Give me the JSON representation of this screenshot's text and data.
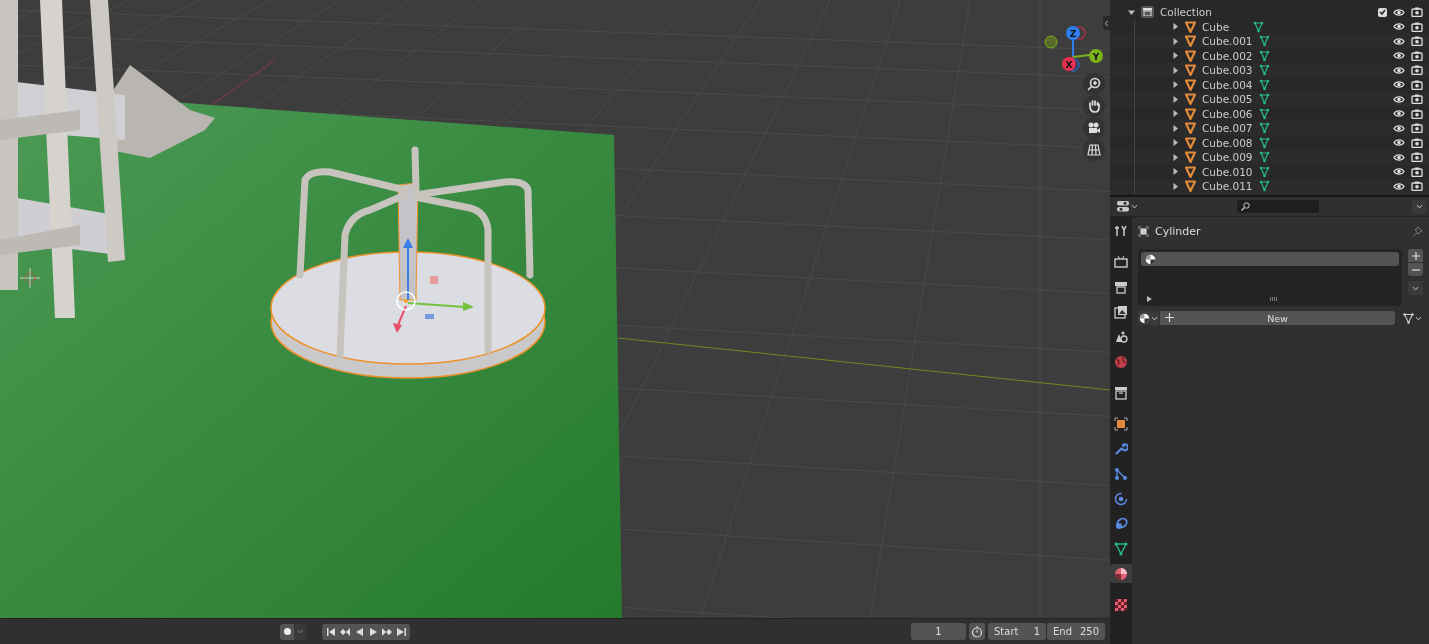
{
  "viewport": {
    "gizmo_axes": [
      "Z",
      "Y",
      "X"
    ]
  },
  "timeline": {
    "current_frame": "1",
    "start_label": "Start",
    "start": "1",
    "end_label": "End",
    "end": "250"
  },
  "outliner": {
    "collection": {
      "name": "Collection",
      "expanded": true,
      "checked": true,
      "children": [
        {
          "name": "Cube",
          "expanded": false
        },
        {
          "name": "Cube.001",
          "expanded": false
        },
        {
          "name": "Cube.002",
          "expanded": false
        },
        {
          "name": "Cube.003",
          "expanded": false
        },
        {
          "name": "Cube.004",
          "expanded": false
        },
        {
          "name": "Cube.005",
          "expanded": false
        },
        {
          "name": "Cube.006",
          "expanded": false
        },
        {
          "name": "Cube.007",
          "expanded": false
        },
        {
          "name": "Cube.008",
          "expanded": false
        },
        {
          "name": "Cube.009",
          "expanded": false
        },
        {
          "name": "Cube.010",
          "expanded": false
        },
        {
          "name": "Cube.011",
          "expanded": false
        }
      ]
    }
  },
  "properties": {
    "tabs": [
      {
        "kind": "tool",
        "selected": false
      },
      {
        "kind": "render",
        "selected": false
      },
      {
        "kind": "output",
        "selected": false
      },
      {
        "kind": "view_layer",
        "selected": false
      },
      {
        "kind": "scene",
        "selected": false
      },
      {
        "kind": "world",
        "selected": false
      },
      {
        "kind": "collection",
        "selected": false
      },
      {
        "kind": "object",
        "selected": false
      },
      {
        "kind": "modifiers",
        "selected": false
      },
      {
        "kind": "particles",
        "selected": false
      },
      {
        "kind": "physics",
        "selected": false
      },
      {
        "kind": "constraints",
        "selected": false
      },
      {
        "kind": "data",
        "selected": false
      },
      {
        "kind": "material",
        "selected": true
      },
      {
        "kind": "texture",
        "selected": false
      }
    ],
    "object_name": "Cylinder",
    "material_slots": [
      {
        "selected": true
      }
    ],
    "new_button": "New"
  }
}
